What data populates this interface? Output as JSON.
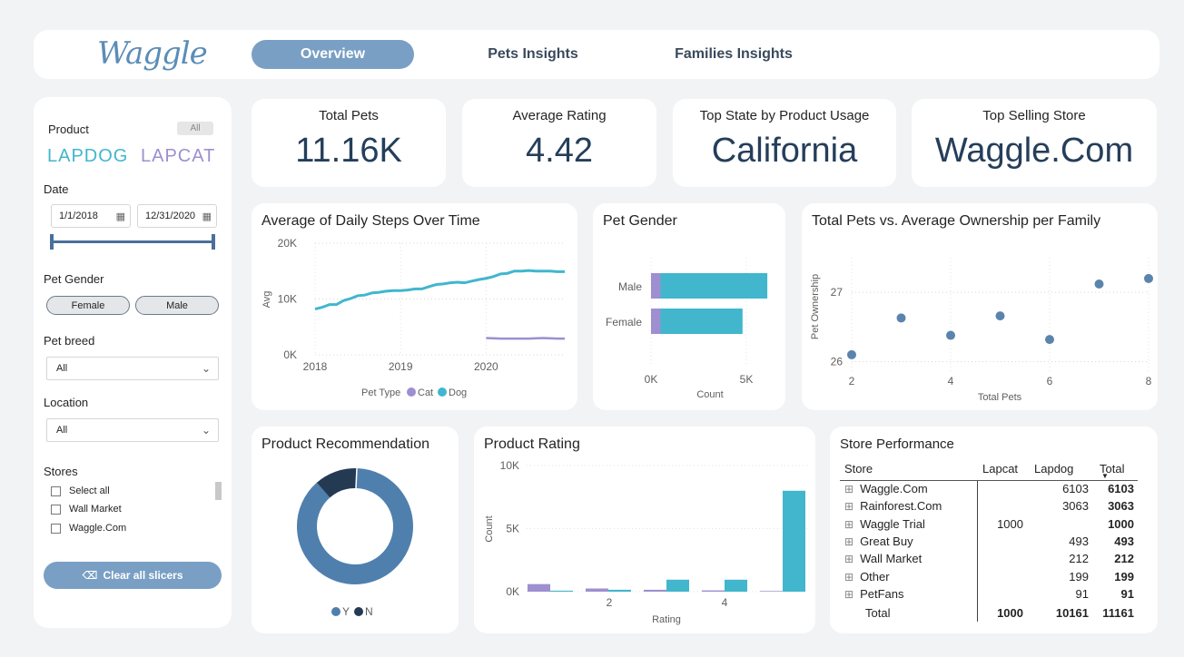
{
  "header": {
    "logo": "Waggle",
    "tabs": [
      "Overview",
      "Pets Insights",
      "Families Insights"
    ]
  },
  "sidebar": {
    "product_label": "Product",
    "product_all": "All",
    "brand1": "LAPDOG",
    "brand2": "LAPCAT",
    "date_label": "Date",
    "date_start": "1/1/2018",
    "date_end": "12/31/2020",
    "gender_label": "Pet Gender",
    "gender_options": [
      "Female",
      "Male"
    ],
    "breed_label": "Pet breed",
    "breed_value": "All",
    "location_label": "Location",
    "location_value": "All",
    "stores_label": "Stores",
    "stores_options": [
      "Select all",
      "Wall Market",
      "Waggle.Com"
    ],
    "clear_button": "Clear all slicers"
  },
  "kpis": [
    {
      "title": "Total Pets",
      "value": "11.16K"
    },
    {
      "title": "Average Rating",
      "value": "4.42"
    },
    {
      "title": "Top State by Product Usage",
      "value": "California"
    },
    {
      "title": "Top Selling Store",
      "value": "Waggle.Com"
    }
  ],
  "colors": {
    "dog": "#41b6cd",
    "cat": "#9d8fd0",
    "accent": "#7a9fc4",
    "dark": "#253e5a",
    "y": "#4f7fad",
    "n": "#243a52"
  },
  "chart_data": [
    {
      "type": "line",
      "title": "Average of Daily Steps Over Time",
      "ylabel": "Avg",
      "x_ticks": [
        "2018",
        "2019",
        "2020"
      ],
      "y_ticks": [
        "0K",
        "10K",
        "20K"
      ],
      "ylim": [
        0,
        20000
      ],
      "legend_title": "Pet Type",
      "series": [
        {
          "name": "Dog",
          "x": [
            2018.0,
            2018.08,
            2018.17,
            2018.25,
            2018.33,
            2018.42,
            2018.5,
            2018.58,
            2018.67,
            2018.75,
            2018.83,
            2018.92,
            2019.0,
            2019.08,
            2019.17,
            2019.25,
            2019.33,
            2019.42,
            2019.5,
            2019.58,
            2019.67,
            2019.75,
            2019.83,
            2019.92,
            2020.0,
            2020.08,
            2020.17,
            2020.25,
            2020.33,
            2020.42,
            2020.5,
            2020.58,
            2020.67,
            2020.75,
            2020.83,
            2020.92
          ],
          "values": [
            8200,
            8500,
            9000,
            9000,
            9700,
            10100,
            10600,
            10700,
            11100,
            11200,
            11400,
            11500,
            11500,
            11600,
            11800,
            11800,
            12200,
            12600,
            12700,
            12900,
            13000,
            12900,
            13200,
            13500,
            13700,
            14000,
            14500,
            14600,
            15000,
            15000,
            15100,
            15000,
            15000,
            15000,
            14900,
            14900
          ]
        },
        {
          "name": "Cat",
          "x": [
            2020.0,
            2020.17,
            2020.33,
            2020.5,
            2020.67,
            2020.83,
            2020.92
          ],
          "values": [
            3000,
            2900,
            2900,
            2900,
            3000,
            2900,
            2900
          ]
        }
      ]
    },
    {
      "type": "bar",
      "title": "Pet Gender",
      "xlabel": "Count",
      "categories": [
        "Male",
        "Female"
      ],
      "x_ticks": [
        "0K",
        "5K"
      ],
      "xlim": [
        0,
        6000
      ],
      "series": [
        {
          "name": "Cat",
          "values": [
            500,
            500
          ]
        },
        {
          "name": "Dog",
          "values": [
            5600,
            4300
          ]
        }
      ]
    },
    {
      "type": "scatter",
      "title": "Total Pets vs. Average Ownership per Family",
      "xlabel": "Total Pets",
      "ylabel": "Pet Ownership",
      "x_ticks": [
        "2",
        "4",
        "6",
        "8"
      ],
      "y_ticks": [
        "26",
        "27"
      ],
      "xlim": [
        2,
        8
      ],
      "ylim": [
        25.85,
        27.5
      ],
      "x": [
        2,
        3,
        4,
        5,
        6,
        7,
        8
      ],
      "y": [
        26.1,
        26.63,
        26.38,
        26.66,
        26.32,
        27.12,
        27.2
      ]
    },
    {
      "type": "pie",
      "title": "Product Recommendation",
      "categories": [
        "Y",
        "N"
      ],
      "values": [
        88,
        12
      ]
    },
    {
      "type": "bar",
      "title": "Product Rating",
      "xlabel": "Rating",
      "ylabel": "Count",
      "y_ticks": [
        "0K",
        "5K",
        "10K"
      ],
      "x_ticks": [
        "2",
        "4"
      ],
      "ylim": [
        0,
        10000
      ],
      "categories": [
        "1",
        "2",
        "3",
        "4",
        "5"
      ],
      "series": [
        {
          "name": "Cat",
          "values": [
            600,
            250,
            150,
            100,
            50
          ]
        },
        {
          "name": "Dog",
          "values": [
            80,
            150,
            950,
            950,
            8000
          ]
        }
      ]
    }
  ],
  "store_table": {
    "title": "Store Performance",
    "columns": [
      "Store",
      "Lapcat",
      "Lapdog",
      "Total"
    ],
    "rows": [
      [
        "Waggle.Com",
        "",
        "6103",
        "6103"
      ],
      [
        "Rainforest.Com",
        "",
        "3063",
        "3063"
      ],
      [
        "Waggle Trial",
        "1000",
        "",
        "1000"
      ],
      [
        "Great Buy",
        "",
        "493",
        "493"
      ],
      [
        "Wall Market",
        "",
        "212",
        "212"
      ],
      [
        "Other",
        "",
        "199",
        "199"
      ],
      [
        "PetFans",
        "",
        "91",
        "91"
      ]
    ],
    "total": [
      "Total",
      "1000",
      "10161",
      "11161"
    ]
  }
}
